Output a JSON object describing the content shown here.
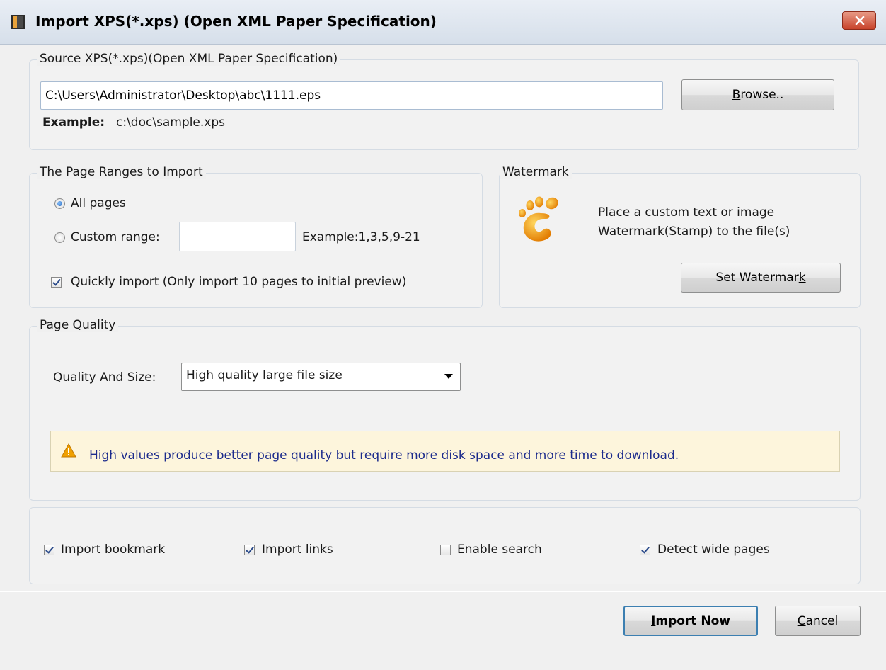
{
  "window": {
    "title": "Import XPS(*.xps) (Open XML Paper Specification)"
  },
  "source": {
    "legend": "Source XPS(*.xps)(Open XML Paper Specification)",
    "path_value": "C:\\Users\\Administrator\\Desktop\\abc\\1111.eps",
    "browse_prefix": "B",
    "browse_rest": "rowse..",
    "example_label": "Example:",
    "example_value": "c:\\doc\\sample.xps"
  },
  "page_ranges": {
    "legend": "The Page Ranges to Import",
    "all_pages_mnemonic": "A",
    "all_pages_rest": "ll pages",
    "all_pages_selected": true,
    "custom_range_label": "Custom range:",
    "custom_range_value": "",
    "custom_example": "Example:1,3,5,9-21",
    "quick_import_label": "Quickly import (Only import 10 pages to  initial  preview)",
    "quick_import_checked": true
  },
  "watermark": {
    "legend": "Watermark",
    "icon": "footprint-logo-icon",
    "description_line1": "Place a custom text or image",
    "description_line2": "Watermark(Stamp) to the file(s)",
    "button_prefix": "Set Watermar",
    "button_mnemonic": "k"
  },
  "page_quality": {
    "legend": "Page Quality",
    "quality_label": "Quality And Size:",
    "selected_option": "High quality large file size",
    "warning_text": "High values produce better page quality but require more disk space and more time to download."
  },
  "options": {
    "import_bookmark": {
      "label": "Import bookmark",
      "checked": true
    },
    "import_links": {
      "label": "Import links",
      "checked": true
    },
    "enable_search": {
      "label": "Enable search",
      "checked": false
    },
    "detect_wide_pages": {
      "label": "Detect wide pages",
      "checked": true
    }
  },
  "footer": {
    "import_now_mnemonic": "I",
    "import_now_rest": "mport Now",
    "cancel_mnemonic": "C",
    "cancel_rest": "ancel"
  },
  "colors": {
    "warning_text": "#1c2b8c",
    "warning_bg": "#fdf5dc",
    "close_button": "#c8432b",
    "default_button_border": "#3c7fb1"
  }
}
